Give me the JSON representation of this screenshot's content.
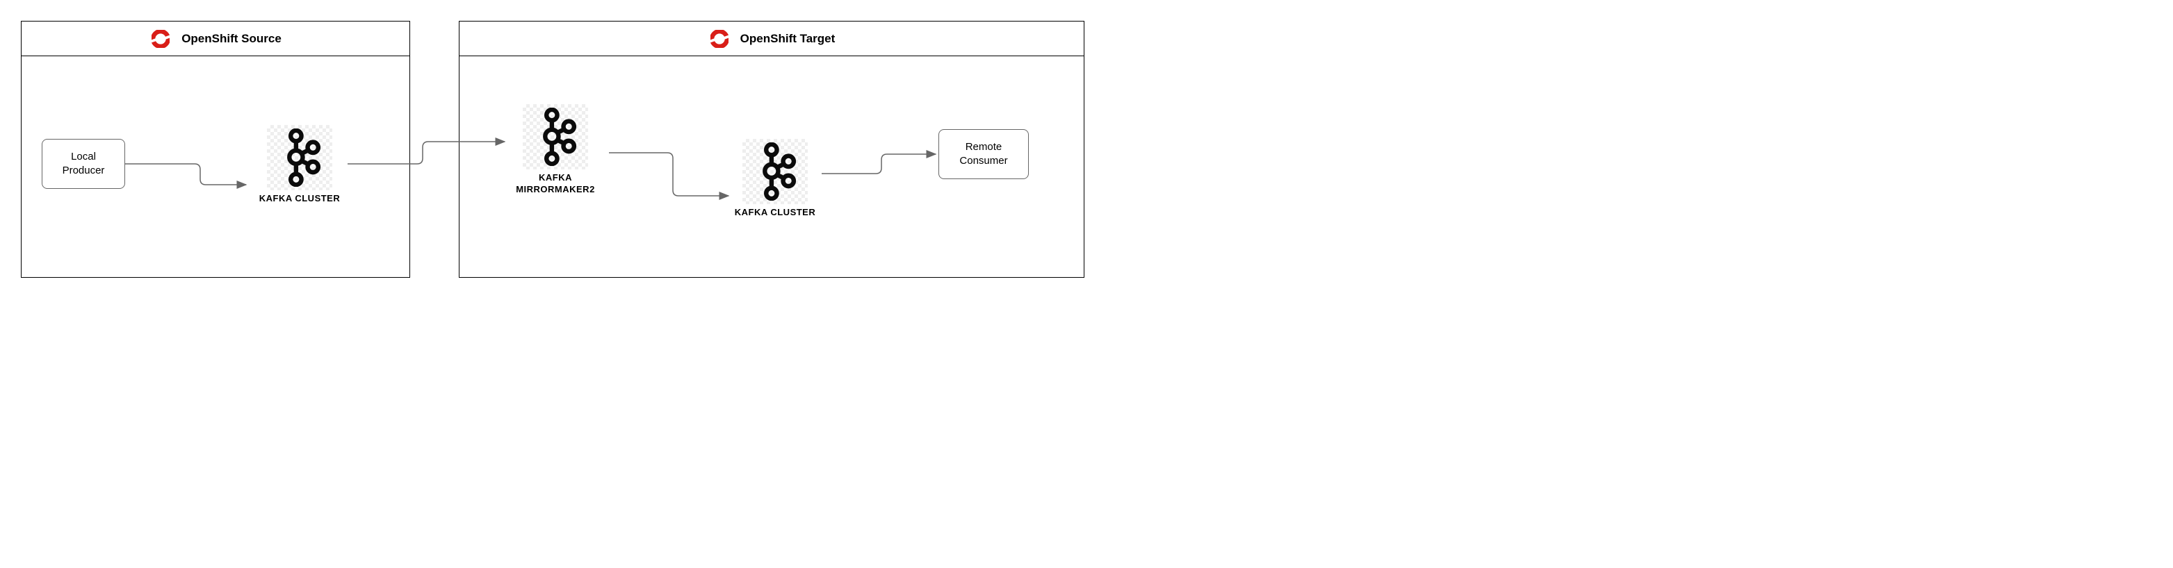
{
  "source": {
    "title": "OpenShift Source",
    "producer": "Local\nProducer",
    "kafka_label": "KAFKA CLUSTER"
  },
  "target": {
    "title": "OpenShift Target",
    "mirrormaker_label": "KAFKA\nMIRRORMAKER2",
    "kafka_label": "KAFKA CLUSTER",
    "consumer": "Remote\nConsumer"
  },
  "icons": {
    "openshift": "openshift-icon",
    "kafka": "kafka-icon"
  }
}
